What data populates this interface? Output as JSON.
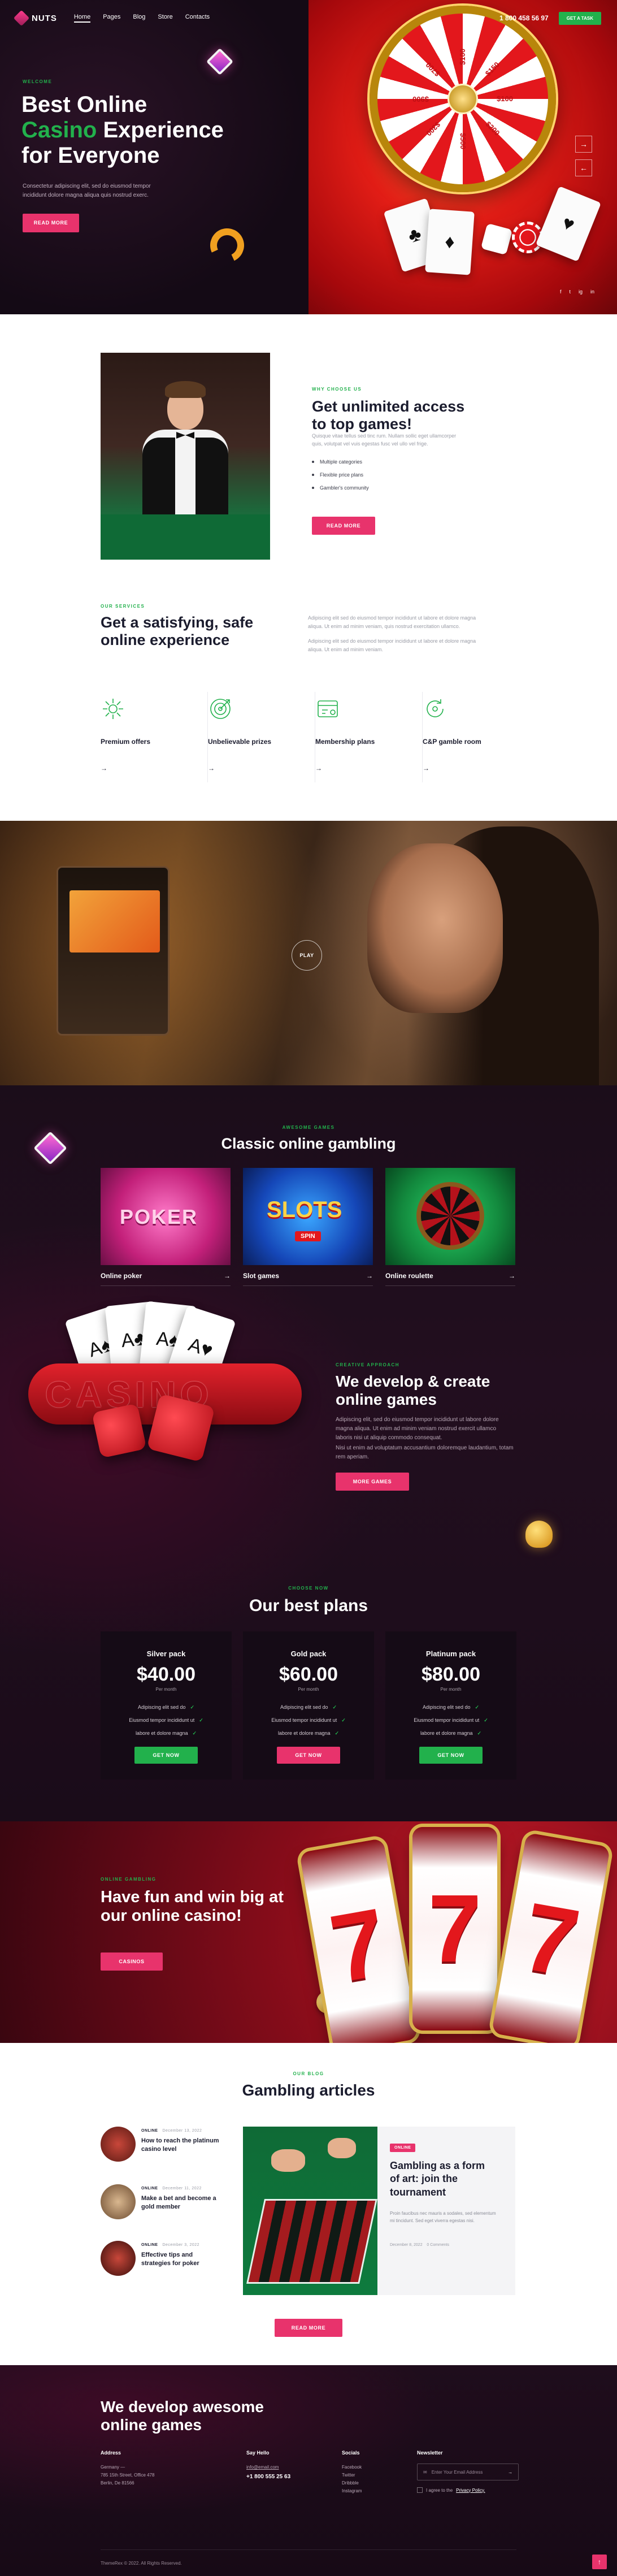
{
  "nav": {
    "logo": "NUTS",
    "menu": [
      "Home",
      "Pages",
      "Blog",
      "Store",
      "Contacts"
    ],
    "phone": "1 800 458 56 97",
    "cta": "GET A TASK"
  },
  "hero": {
    "kicker": "WELCOME",
    "title_line1": "Best Online",
    "title_green": "Casino",
    "title_rest": " Experience",
    "title_line3": "for Everyone",
    "text": "Consectetur adipiscing elit, sed do eiusmod tempor incididunt dolore magna aliqua quis nostrud exerc.",
    "button": "READ MORE",
    "wheel_labels": [
      "$100",
      "$200",
      "$500",
      "$300",
      "$900",
      "$700",
      "$100",
      "$150"
    ],
    "arrows": [
      "→",
      "←"
    ],
    "socials": [
      "f",
      "t",
      "ig",
      "in"
    ]
  },
  "about": {
    "kicker": "WHY CHOOSE US",
    "title": "Get unlimited access to top games!",
    "text": "Quisque vitae tellus sed tinc rum. Nullam sollic eget ullamcorper quis, volutpat vel vuis egestas fusc vel ullo vel frige.",
    "list": [
      "Multiple categories",
      "Flexible price plans",
      "Gambler's community"
    ],
    "button": "READ MORE"
  },
  "services": {
    "kicker": "OUR SERVICES",
    "title": "Get a satisfying, safe online experience",
    "text1": "Adipiscing elit sed do eiusmod tempor incididunt ut labore et dolore magna aliqua. Ut enim ad minim veniam, quis nostrud exercitation ullamco.",
    "text2": "Adipiscing elit sed do eiusmod tempor incididunt ut labore et dolore magna aliqua. Ut enim ad minim veniam.",
    "features": [
      {
        "title": "Premium offers",
        "arrow": "→"
      },
      {
        "title": "Unbelievable prizes",
        "arrow": "→"
      },
      {
        "title": "Membership plans",
        "arrow": "→"
      },
      {
        "title": "C&P gamble room",
        "arrow": "→"
      }
    ]
  },
  "video": {
    "play": "PLAY"
  },
  "games": {
    "kicker": "AWESOME GAMES",
    "title": "Classic online gambling",
    "items": [
      {
        "label": "Online poker",
        "arrow": "→",
        "art": "POKER"
      },
      {
        "label": "Slot games",
        "arrow": "→",
        "art": "SLOTS",
        "badge": "SPIN"
      },
      {
        "label": "Online roulette",
        "arrow": "→"
      }
    ]
  },
  "develop": {
    "kicker": "CREATIVE APPROACH",
    "title": "We develop & create online games",
    "text1": "Adipiscing elit, sed do eiusmod tempor incididunt ut labore dolore magna aliqua. Ut enim ad minim veniam nostrud exercit ullamco laboris nisi ut aliquip commodo consequat.",
    "text2": "Nisi ut enim ad voluptatum accusantium doloremque laudantium, totam rem aperiam.",
    "button": "MORE GAMES",
    "sign": "CASINO"
  },
  "plans": {
    "kicker": "CHOOSE NOW",
    "title": "Our best plans",
    "items": [
      {
        "name": "Silver pack",
        "price": "$40.00",
        "per": "Per month",
        "features": [
          "Adipiscing elit sed do",
          "Eiusmod tempor incididunt ut",
          "labore et dolore magna"
        ],
        "button": "GET NOW",
        "color": "#22b14c"
      },
      {
        "name": "Gold pack",
        "price": "$60.00",
        "per": "Per month",
        "features": [
          "Adipiscing elit sed do",
          "Eiusmod tempor incididunt ut",
          "labore et dolore magna"
        ],
        "button": "GET NOW",
        "color": "#e8336c"
      },
      {
        "name": "Platinum pack",
        "price": "$80.00",
        "per": "Per month",
        "features": [
          "Adipiscing elit sed do",
          "Eiusmod tempor incididunt ut",
          "labore et dolore magna"
        ],
        "button": "GET NOW",
        "color": "#22b14c"
      }
    ],
    "check": "✓"
  },
  "cta": {
    "kicker": "ONLINE GAMBLING",
    "title": "Have fun and win big at our online casino!",
    "button": "CASINOS",
    "reels": [
      "7",
      "7",
      "7"
    ]
  },
  "blog": {
    "kicker": "OUR BLOG",
    "title": "Gambling articles",
    "posts": [
      {
        "tag": "ONLINE",
        "date": "December 13, 2022",
        "title": "How to reach the platinum casino level"
      },
      {
        "tag": "ONLINE",
        "date": "December 11, 2022",
        "title": "Make a bet and become a gold member"
      },
      {
        "tag": "ONLINE",
        "date": "December 3, 2022",
        "title": "Effective tips and strategies for poker"
      }
    ],
    "featured": {
      "tag": "ONLINE",
      "title": "Gambling as a form of art: join the tournament",
      "text": "Proin faucibus nec mauris a sodales, sed elementum mi tincidunt. Sed eget viverra egestas nisi.",
      "date": "December 8, 2022",
      "comments": "0 Comments"
    },
    "button": "READ MORE"
  },
  "footer": {
    "title": "We develop awesome online games",
    "address_h": "Address",
    "address": [
      "Germany —",
      "785 15th Street, Office 478",
      "Berlin, De 81566"
    ],
    "hello_h": "Say Hello",
    "email": "info@email.com",
    "phone": "+1 800 555 25 63",
    "socials_h": "Socials",
    "socials": [
      "Facebook",
      "Twitter",
      "Dribbble",
      "Instagram"
    ],
    "newsletter_h": "Newsletter",
    "newsletter_placeholder": "Enter Your Email Address",
    "agree": "I agree to the",
    "policy": "Privacy Policy.",
    "copyright": "ThemeRex © 2022. All Rights Reserved.",
    "totop": "↑"
  }
}
